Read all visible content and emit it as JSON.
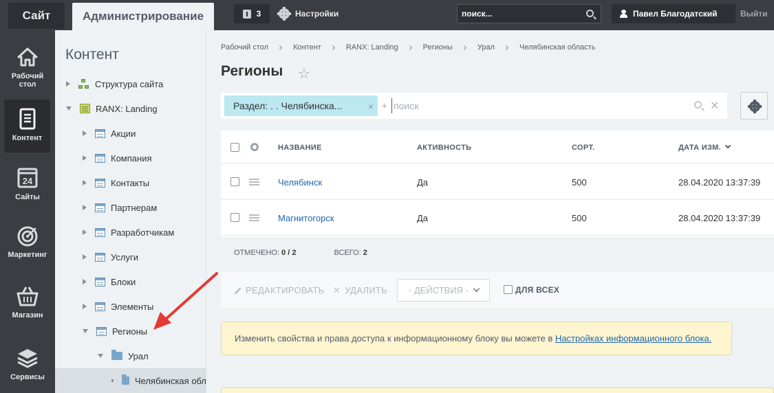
{
  "topbar": {
    "site_tab": "Сайт",
    "admin_tab": "Администрирование",
    "notifications_count": "3",
    "settings_label": "Настройки",
    "search_placeholder": "поиск...",
    "user_name": "Павел Благодатский",
    "logout_label": "Выйти"
  },
  "rail": {
    "items": [
      {
        "label": "Рабочий стол",
        "icon": "home-icon"
      },
      {
        "label": "Контент",
        "icon": "document-icon",
        "active": true
      },
      {
        "label": "Сайты",
        "icon": "calendar-24-icon"
      },
      {
        "label": "Маркетинг",
        "icon": "target-icon"
      },
      {
        "label": "Магазин",
        "icon": "basket-icon"
      },
      {
        "label": "Сервисы",
        "icon": "layers-icon"
      }
    ]
  },
  "tree": {
    "title": "Контент",
    "items": [
      {
        "label": "Структура сайта"
      },
      {
        "label": "RANX: Landing"
      },
      {
        "label": "Акции"
      },
      {
        "label": "Компания"
      },
      {
        "label": "Контакты"
      },
      {
        "label": "Партнерам"
      },
      {
        "label": "Разработчикам"
      },
      {
        "label": "Услуги"
      },
      {
        "label": "Блоки"
      },
      {
        "label": "Элементы"
      },
      {
        "label": "Регионы"
      },
      {
        "label": "Урал"
      },
      {
        "label": "Челябинская обл"
      }
    ]
  },
  "breadcrumbs": [
    "Рабочий стол",
    "Контент",
    "RANX: Landing",
    "Регионы",
    "Урал",
    "Челябинская область"
  ],
  "page": {
    "title": "Регионы"
  },
  "filter": {
    "chip_label": "Раздел: . . Челябинска...",
    "plus": "+",
    "search_placeholder": "поиск"
  },
  "grid": {
    "columns": {
      "name": "НАЗВАНИЕ",
      "active": "АКТИВНОСТЬ",
      "sort": "СОРТ.",
      "date": "ДАТА ИЗМ."
    },
    "rows": [
      {
        "name": "Челябинск",
        "active": "Да",
        "sort": "500",
        "date": "28.04.2020 13:37:39"
      },
      {
        "name": "Магнитогорск",
        "active": "Да",
        "sort": "500",
        "date": "28.04.2020 13:37:39"
      }
    ]
  },
  "stats": {
    "selected_label": "ОТМЕЧЕНО:",
    "selected_value": "0 / 2",
    "total_label": "ВСЕГО:",
    "total_value": "2"
  },
  "actions": {
    "edit": "РЕДАКТИРОВАТЬ",
    "delete": "УДАЛИТЬ",
    "dropdown": "- ДЕЙСТВИЯ -",
    "for_all": "ДЛЯ ВСЕХ"
  },
  "notice": {
    "text": "Изменить свойства и права доступа к информационному блоку вы можете в ",
    "link": "Настройках информационного блока."
  },
  "colors": {
    "topbar_bg": "#3a3d42",
    "accent_link": "#2067b0",
    "chip_bg": "#bce8f1",
    "pointer_arrow": "#e53935"
  }
}
